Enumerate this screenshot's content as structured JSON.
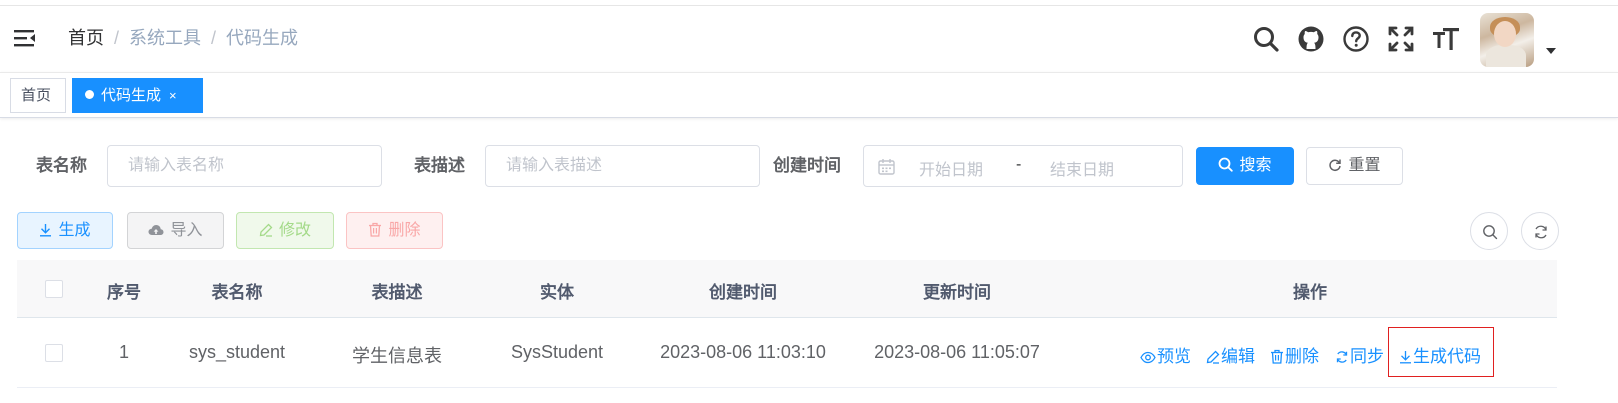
{
  "breadcrumb": {
    "items": [
      "首页",
      "系统工具",
      "代码生成"
    ],
    "separator": "/"
  },
  "navbar": {
    "icons": [
      "search-icon",
      "github-icon",
      "question-icon",
      "fullscreen-icon",
      "font-size-icon"
    ]
  },
  "tags": {
    "home": "首页",
    "active": "代码生成",
    "close": "×"
  },
  "search": {
    "table_name_label": "表名称",
    "table_name_placeholder": "请输入表名称",
    "table_desc_label": "表描述",
    "table_desc_placeholder": "请输入表描述",
    "create_time_label": "创建时间",
    "start_placeholder": "开始日期",
    "range_separator": "-",
    "end_placeholder": "结束日期",
    "search_button": "搜索",
    "reset_button": "重置"
  },
  "toolbar": {
    "generate": "生成",
    "import": "导入",
    "edit": "修改",
    "delete": "删除"
  },
  "table": {
    "headers": [
      "序号",
      "表名称",
      "表描述",
      "实体",
      "创建时间",
      "更新时间",
      "操作"
    ],
    "rows": [
      {
        "index": "1",
        "table_name": "sys_student",
        "table_desc": "学生信息表",
        "entity": "SysStudent",
        "create_time": "2023-08-06 11:03:10",
        "update_time": "2023-08-06 11:05:07",
        "actions": [
          "预览",
          "编辑",
          "删除",
          "同步",
          "生成代码"
        ]
      }
    ]
  },
  "colors": {
    "primary": "#1890ff",
    "highlight_border": "#e02020"
  }
}
